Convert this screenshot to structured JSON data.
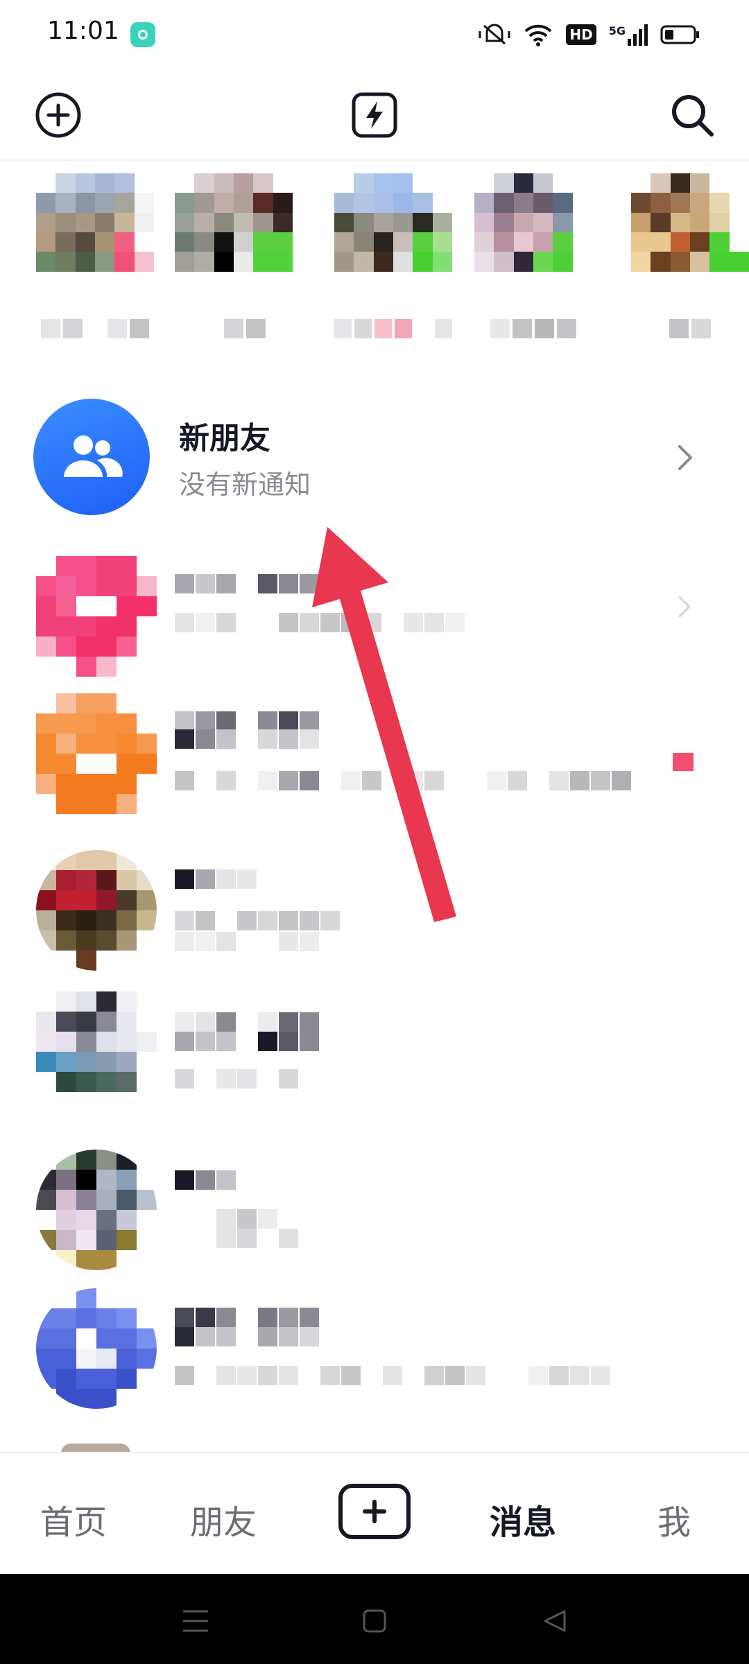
{
  "status_bar": {
    "time": "11:01",
    "network": "5G",
    "hd": "HD"
  },
  "new_friends": {
    "title": "新朋友",
    "subtitle": "没有新通知"
  },
  "tabs": [
    {
      "label": "首页",
      "active": false
    },
    {
      "label": "朋友",
      "active": false
    },
    {
      "label": "消息",
      "active": true
    },
    {
      "label": "我",
      "active": false
    }
  ],
  "colors": {
    "accent_blue": "#2d74ff",
    "arrow_red": "#e8374f",
    "unread_badge": "#f0506e",
    "text_primary": "#161823",
    "text_secondary": "#8a8b91"
  },
  "icons": {
    "top_left": "add-circle-icon",
    "top_center": "lightning-icon",
    "top_right": "search-icon",
    "create": "plus-icon"
  }
}
